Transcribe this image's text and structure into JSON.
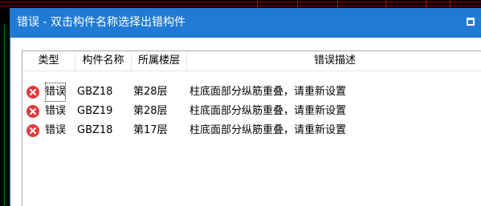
{
  "dialog": {
    "title": "错误 - 双击构件名称选择出错构件",
    "maximize_icon": "maximize-icon"
  },
  "table": {
    "columns": [
      "类型",
      "构件名称",
      "所属楼层",
      "错误描述"
    ],
    "rows": [
      {
        "icon": "error-icon",
        "type": "错误",
        "name": "GBZ18",
        "floor": "第28层",
        "desc": "柱底面部分纵筋重叠，请重新设置"
      },
      {
        "icon": "error-icon",
        "type": "错误",
        "name": "GBZ19",
        "floor": "第28层",
        "desc": "柱底面部分纵筋重叠，请重新设置"
      },
      {
        "icon": "error-icon",
        "type": "错误",
        "name": "GBZ18",
        "floor": "第17层",
        "desc": "柱底面部分纵筋重叠，请重新设置"
      }
    ]
  },
  "colors": {
    "titlebar": "#1f7bd4",
    "error_icon": "#e23b3b",
    "background": "#000000"
  }
}
